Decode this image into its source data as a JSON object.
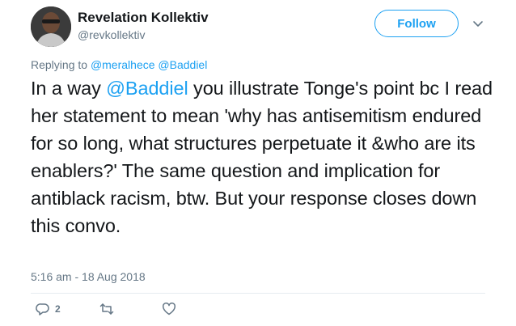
{
  "user": {
    "display_name": "Revelation Kollektiv",
    "handle": "@revkollektiv"
  },
  "follow_label": "Follow",
  "reply_context": {
    "prefix": "Replying to",
    "mentions": [
      "@meralhece",
      "@Baddiel"
    ]
  },
  "tweet": {
    "text_before": "In a way ",
    "mention": "@Baddiel",
    "text_after": " you illustrate Tonge's point bc I read her statement to mean 'why has antisemitism endured for so long, what structures perpetuate it &who are its enablers?' The same question and implication for antiblack racism, btw. But your response closes down this convo."
  },
  "timestamp": "5:16 am - 18 Aug 2018",
  "actions": {
    "reply_count": "2"
  },
  "icons": {
    "caret": "chevron-down-icon",
    "reply": "reply-icon",
    "retweet": "retweet-icon",
    "like": "heart-icon"
  },
  "colors": {
    "accent": "#1da1f2",
    "secondary_text": "#657786",
    "primary_text": "#14171a"
  }
}
